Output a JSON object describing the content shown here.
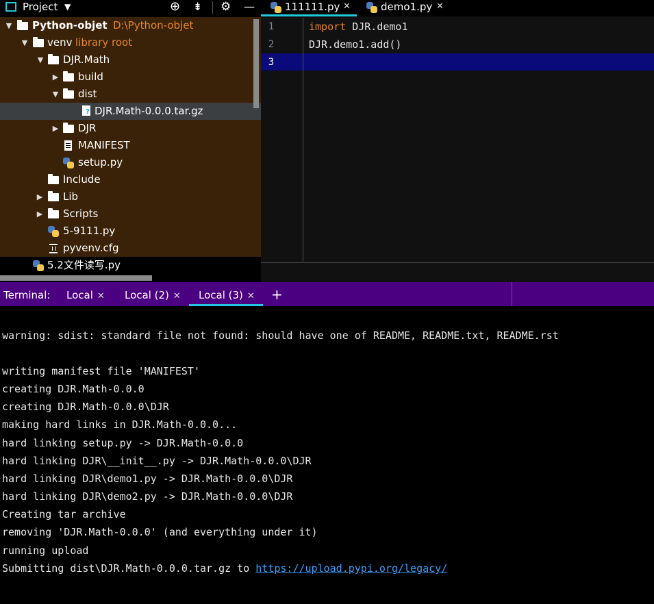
{
  "project_header": {
    "title": "Project",
    "dropdown_icon": "chevron-down-icon"
  },
  "tree": [
    {
      "label": "Python-objet",
      "sub": "D:\\Python-objet",
      "type": "folder",
      "expanded": true
    },
    {
      "label": "venv",
      "sub": "library root",
      "type": "folder",
      "expanded": true
    },
    {
      "label": "DJR.Math",
      "type": "folder",
      "expanded": true
    },
    {
      "label": "build",
      "type": "folder",
      "expanded": false
    },
    {
      "label": "dist",
      "type": "folder",
      "expanded": true
    },
    {
      "label": "DJR.Math-0.0.0.tar.gz",
      "type": "archive",
      "selected": true
    },
    {
      "label": "DJR",
      "type": "folder",
      "expanded": false
    },
    {
      "label": "MANIFEST",
      "type": "text-file"
    },
    {
      "label": "setup.py",
      "type": "python-file"
    },
    {
      "label": "Include",
      "type": "folder"
    },
    {
      "label": "Lib",
      "type": "folder",
      "expanded": false
    },
    {
      "label": "Scripts",
      "type": "folder",
      "expanded": false
    },
    {
      "label": "5-9111.py",
      "type": "python-file"
    },
    {
      "label": "pyvenv.cfg",
      "type": "config-file"
    },
    {
      "label": "5.2文件读写.py",
      "type": "python-file"
    }
  ],
  "editor": {
    "tabs": [
      {
        "label": "111111.py",
        "active": true
      },
      {
        "label": "demo1.py",
        "active": false
      }
    ],
    "lines": [
      {
        "number": "1",
        "keyword": "import",
        "rest": " DJR.demo1"
      },
      {
        "number": "2",
        "keyword": "",
        "rest": "DJR.demo1.add()"
      },
      {
        "number": "3",
        "keyword": "",
        "rest": ""
      }
    ]
  },
  "terminal": {
    "label": "Terminal:",
    "tabs": [
      {
        "label": "Local",
        "active": false
      },
      {
        "label": "Local (2)",
        "active": false
      },
      {
        "label": "Local (3)",
        "active": true
      }
    ],
    "add_label": "+",
    "lines": [
      "warning: sdist: standard file not found: should have one of README, README.txt, README.rst",
      "",
      "writing manifest file 'MANIFEST'",
      "creating DJR.Math-0.0.0",
      "creating DJR.Math-0.0.0\\DJR",
      "making hard links in DJR.Math-0.0.0...",
      "hard linking setup.py -> DJR.Math-0.0.0",
      "hard linking DJR\\__init__.py -> DJR.Math-0.0.0\\DJR",
      "hard linking DJR\\demo1.py -> DJR.Math-0.0.0\\DJR",
      "hard linking DJR\\demo2.py -> DJR.Math-0.0.0\\DJR",
      "Creating tar archive",
      "removing 'DJR.Math-0.0.0' (and everything under it)",
      "running upload"
    ],
    "last_line_prefix": "Submitting dist\\DJR.Math-0.0.0.tar.gz to ",
    "last_line_link": "https://upload.pypi.org/legacy/"
  },
  "colors": {
    "library_bg": "#3a2208",
    "accent_orange": "#e6862a",
    "terminal_tabs_bg": "#4b0082",
    "caret_line_bg": "#0a0a7a",
    "link_blue": "#3aa0ff",
    "active_tab_underline": "#20c8e0"
  }
}
